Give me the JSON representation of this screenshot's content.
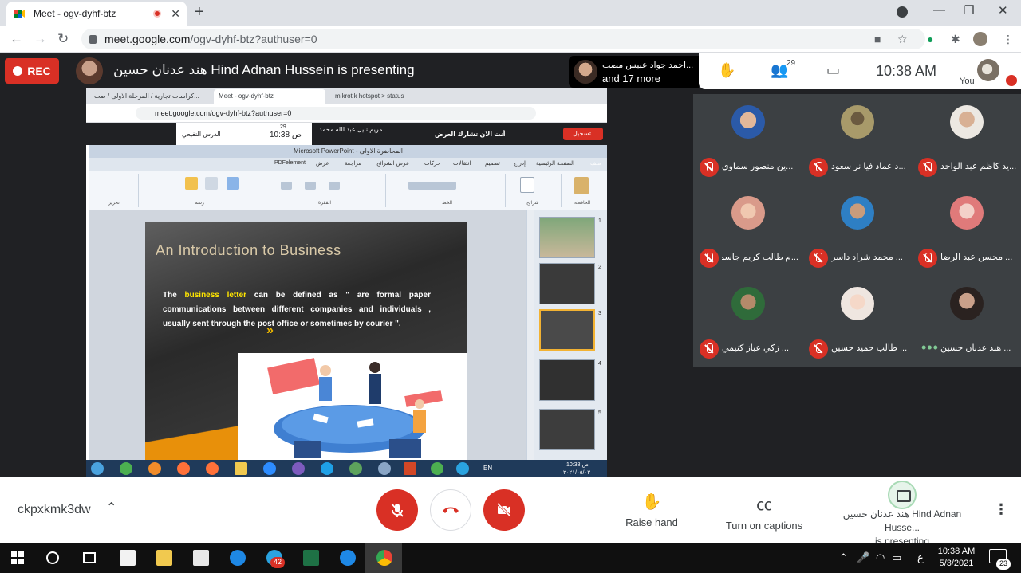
{
  "browser": {
    "tab_title": "Meet - ogv-dyhf-btz",
    "url_host": "meet.google.com",
    "url_path": "/ogv-dyhf-btz?authuser=0",
    "new_tab": "+",
    "tab_close": "✕",
    "minimize": "—",
    "maximize": "❐",
    "close": "✕"
  },
  "meet": {
    "rec_label": "REC",
    "presenter_arabic": "هند عدنان حسين",
    "presenter_banner": "Hind Adnan Hussein is presenting",
    "people_chip_line1": "احمد جواد عبيس مصب...",
    "people_chip_line2": "and 17 more",
    "participants_count": "29",
    "time": "10:38  AM",
    "you_label": "You",
    "meeting_code": "ckpxkmk3dw",
    "raise_hand": "Raise hand",
    "captions": "Turn on captions",
    "presenting_line1": "هند عدنان حسين Hind Adnan Husse...",
    "presenting_line2": "is presenting"
  },
  "shared": {
    "inner_tab1": "كراسات تجارية / المرحلة الاولى / صب...",
    "inner_tab2": "Meet - ogv-dyhf-btz",
    "inner_tab3": "mikrotik hotspot > status",
    "inner_url": "meet.google.com/ogv-dyhf-btz?authuser=0",
    "inner_time": "10:38 ص",
    "inner_count": "29",
    "inner_presenting": "أنت الآن تشارك العرض",
    "inner_person": "مريم نبيل عبد الله محمد ...",
    "inner_rec": "تسجيل",
    "inner_you": "الدرس النفيعي",
    "ppt_title": "Microsoft PowerPoint - المحاضرة الاولى",
    "ppt_tabs": [
      "PDFelement",
      "عرض",
      "مراجعة",
      "عرض الشرائح",
      "حركات",
      "انتقالات",
      "تصميم",
      "إدراج",
      "الصفحة الرئيسية",
      "ملف"
    ],
    "ribbon_groups": [
      "تحرير",
      "رسم",
      "الفقرة",
      "الخط",
      "شرائح",
      "الحافظة"
    ],
    "slide_title": "An Introduction to Business",
    "slide_text_pre": "The ",
    "slide_text_hl": "business letter",
    "slide_text_post": "  can be defined as  \" are formal  paper communications between different companies and individuals , usually sent through the post office or sometimes by courier \".",
    "slide_quote": "»",
    "thumb_numbers": [
      "1",
      "2",
      "3",
      "4",
      "5"
    ],
    "inner_task_lang": "EN",
    "inner_task_time": "10:38 ص",
    "inner_task_date": "٢٠٢١/٠٥/٠٣"
  },
  "participants": [
    {
      "name": "...ين منصور سماوي"
    },
    {
      "name": "...د عماد فيا نر سعود"
    },
    {
      "name": "...يد كاظم عبد الواحد"
    },
    {
      "name": "...م طالب كريم جاسم"
    },
    {
      "name": "... محمد شراد داسر"
    },
    {
      "name": "... محسن عبد الرضا"
    },
    {
      "name": "... زكي عباز كنيمي"
    },
    {
      "name": "... طالب حميد حسين"
    },
    {
      "name": "... هند عدنان حسين"
    }
  ],
  "taskbar": {
    "time": "10:38 AM",
    "date": "5/3/2021",
    "lang": "ع",
    "telegram_badge": "42",
    "notif_badge": "23"
  },
  "colors": {
    "meet_red": "#d93025",
    "meet_bg": "#202124",
    "tile_bg": "#3c4043"
  }
}
